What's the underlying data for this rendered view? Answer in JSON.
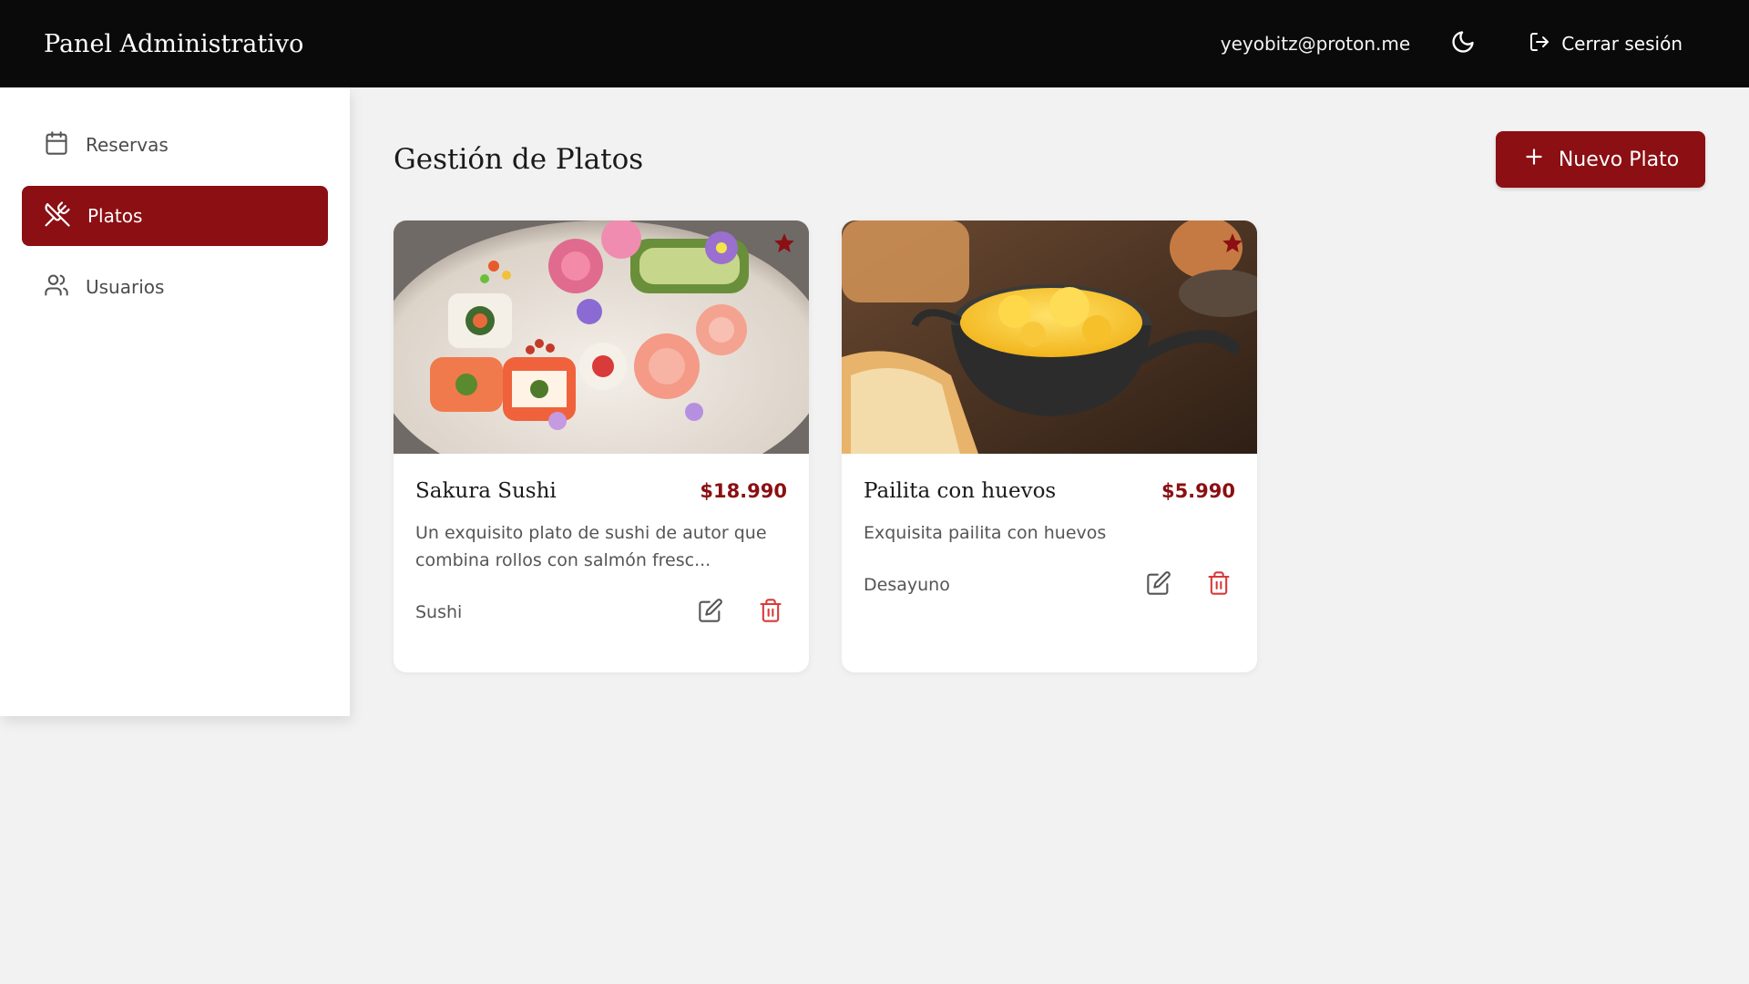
{
  "colors": {
    "accent": "#8b0f13",
    "topbar": "#0a0a0b",
    "background": "#f3f2f2",
    "delete": "#d83a3a"
  },
  "topbar": {
    "title": "Panel Administrativo",
    "user_email": "yeyobitz@proton.me",
    "theme_icon": "moon-icon",
    "logout_label": "Cerrar sesión"
  },
  "sidebar": {
    "items": [
      {
        "label": "Reservas",
        "icon": "calendar-icon",
        "active": false
      },
      {
        "label": "Platos",
        "icon": "utensils-crossed-icon",
        "active": true
      },
      {
        "label": "Usuarios",
        "icon": "users-icon",
        "active": false
      }
    ]
  },
  "main": {
    "title": "Gestión de Platos",
    "new_button_label": "Nuevo Plato",
    "dishes": [
      {
        "name": "Sakura Sushi",
        "price": "$18.990",
        "description": "Un exquisito plato de sushi de autor que combina rollos con salmón fresc...",
        "category": "Sushi",
        "featured": true
      },
      {
        "name": "Pailita con huevos",
        "price": "$5.990",
        "description": "Exquisita pailita con huevos",
        "category": "Desayuno",
        "featured": true
      }
    ]
  }
}
